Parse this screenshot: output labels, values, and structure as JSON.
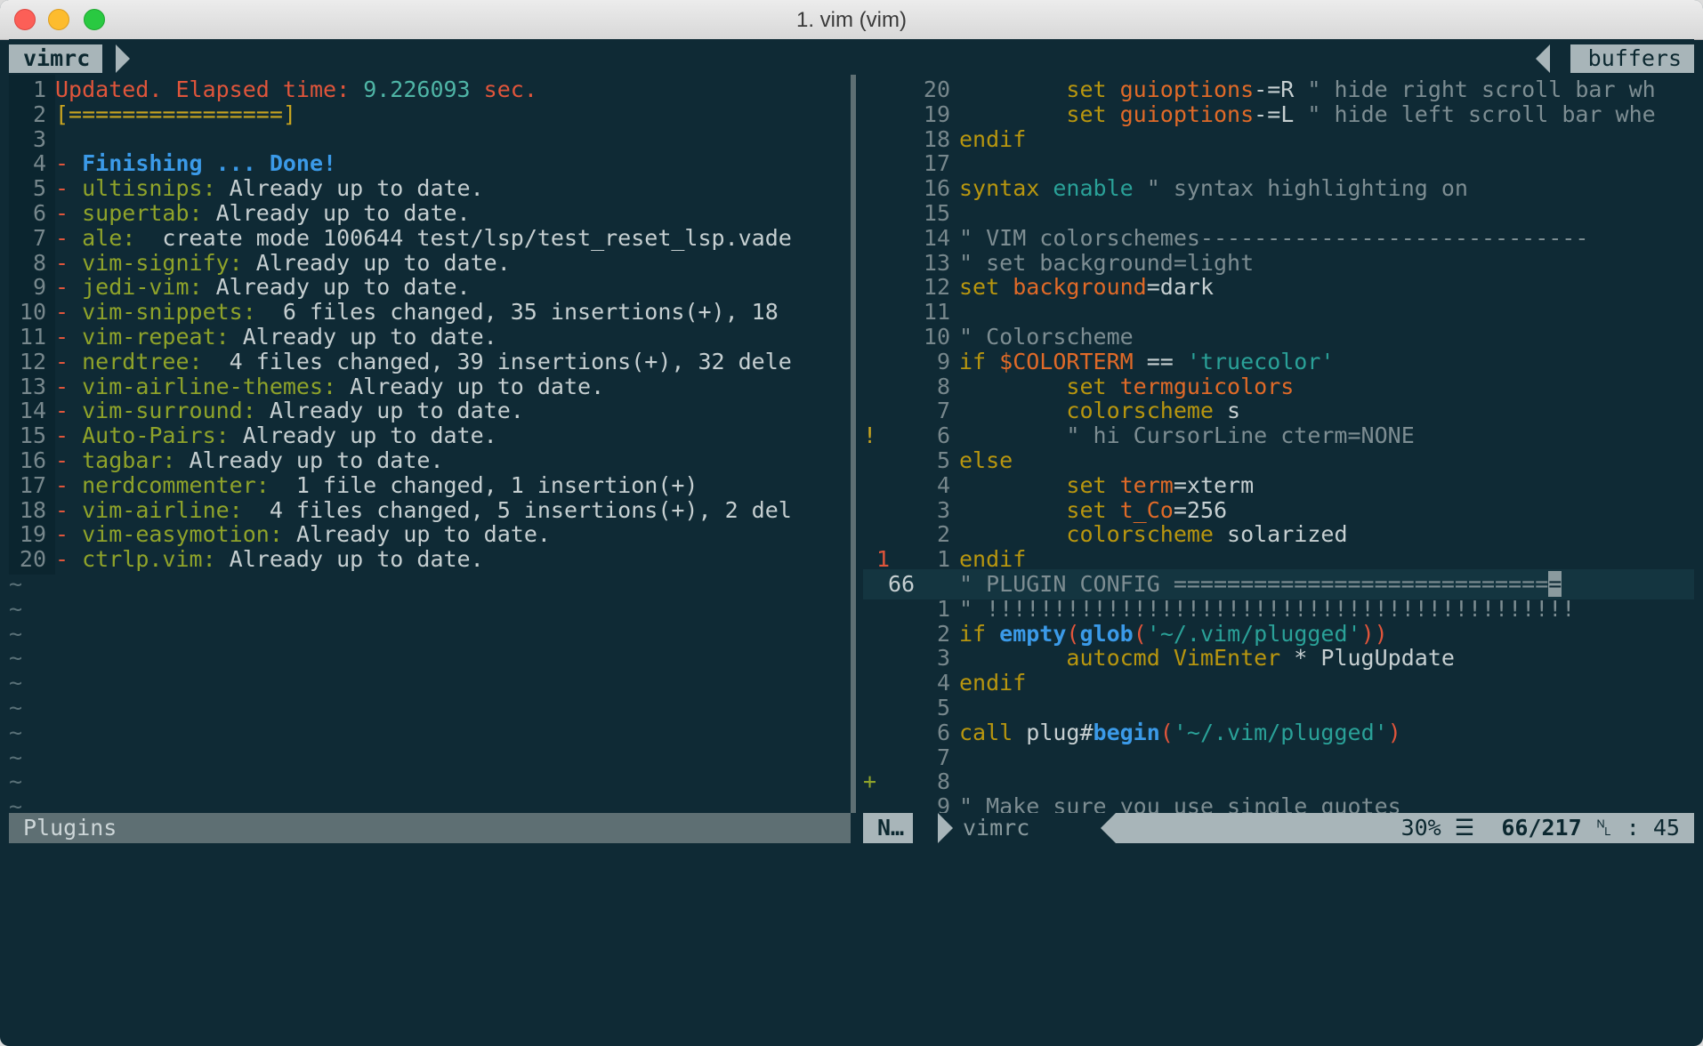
{
  "window": {
    "title": "1. vim (vim)"
  },
  "tabline": {
    "active_tab": "vimrc",
    "right_label": "buffers"
  },
  "left_pane": {
    "lines": [
      {
        "n": "1",
        "segs": [
          [
            "Updated. Elapsed time: ",
            "red"
          ],
          [
            "9.226093",
            "teal"
          ],
          [
            " sec.",
            "red"
          ]
        ]
      },
      {
        "n": "2",
        "segs": [
          [
            "[================]",
            "yellow"
          ]
        ]
      },
      {
        "n": "3",
        "segs": []
      },
      {
        "n": "4",
        "segs": [
          [
            "- ",
            "red"
          ],
          [
            "Finishing ... Done!",
            "blue"
          ]
        ]
      },
      {
        "n": "5",
        "segs": [
          [
            "- ",
            "red"
          ],
          [
            "ultisnips:",
            "green"
          ],
          [
            " Already up to date.",
            "text"
          ]
        ]
      },
      {
        "n": "6",
        "segs": [
          [
            "- ",
            "red"
          ],
          [
            "supertab:",
            "green"
          ],
          [
            " Already up to date.",
            "text"
          ]
        ]
      },
      {
        "n": "7",
        "segs": [
          [
            "- ",
            "red"
          ],
          [
            "ale:",
            "green"
          ],
          [
            "  create mode 100644 test/lsp/test_reset_lsp.vade",
            "text"
          ]
        ]
      },
      {
        "n": "8",
        "segs": [
          [
            "- ",
            "red"
          ],
          [
            "vim-signify:",
            "green"
          ],
          [
            " Already up to date.",
            "text"
          ]
        ]
      },
      {
        "n": "9",
        "segs": [
          [
            "- ",
            "red"
          ],
          [
            "jedi-vim:",
            "green"
          ],
          [
            " Already up to date.",
            "text"
          ]
        ]
      },
      {
        "n": "10",
        "segs": [
          [
            "- ",
            "red"
          ],
          [
            "vim-snippets:",
            "green"
          ],
          [
            "  6 files changed, 35 insertions(+), 18",
            "text"
          ]
        ]
      },
      {
        "n": "11",
        "segs": [
          [
            "- ",
            "red"
          ],
          [
            "vim-repeat:",
            "green"
          ],
          [
            " Already up to date.",
            "text"
          ]
        ]
      },
      {
        "n": "12",
        "segs": [
          [
            "- ",
            "red"
          ],
          [
            "nerdtree:",
            "green"
          ],
          [
            "  4 files changed, 39 insertions(+), 32 dele",
            "text"
          ]
        ]
      },
      {
        "n": "13",
        "segs": [
          [
            "- ",
            "red"
          ],
          [
            "vim-airline-themes:",
            "green"
          ],
          [
            " Already up to date.",
            "text"
          ]
        ]
      },
      {
        "n": "14",
        "segs": [
          [
            "- ",
            "red"
          ],
          [
            "vim-surround:",
            "green"
          ],
          [
            " Already up to date.",
            "text"
          ]
        ]
      },
      {
        "n": "15",
        "segs": [
          [
            "- ",
            "red"
          ],
          [
            "Auto-Pairs:",
            "green"
          ],
          [
            " Already up to date.",
            "text"
          ]
        ]
      },
      {
        "n": "16",
        "segs": [
          [
            "- ",
            "red"
          ],
          [
            "tagbar:",
            "green"
          ],
          [
            " Already up to date.",
            "text"
          ]
        ]
      },
      {
        "n": "17",
        "segs": [
          [
            "- ",
            "red"
          ],
          [
            "nerdcommenter:",
            "green"
          ],
          [
            "  1 file changed, 1 insertion(+)",
            "text"
          ]
        ]
      },
      {
        "n": "18",
        "segs": [
          [
            "- ",
            "red"
          ],
          [
            "vim-airline:",
            "green"
          ],
          [
            "  4 files changed, 5 insertions(+), 2 del",
            "text"
          ]
        ]
      },
      {
        "n": "19",
        "segs": [
          [
            "- ",
            "red"
          ],
          [
            "vim-easymotion:",
            "green"
          ],
          [
            " Already up to date.",
            "text"
          ]
        ]
      },
      {
        "n": "20",
        "segs": [
          [
            "- ",
            "red"
          ],
          [
            "ctrlp.vim:",
            "green"
          ],
          [
            " Already up to date.",
            "text"
          ]
        ]
      }
    ],
    "tilde": "~",
    "tilde_count": 10
  },
  "right_pane": {
    "lines": [
      {
        "sign": "",
        "n": "20",
        "segs": [
          [
            "        set ",
            "kw"
          ],
          [
            "guioptions",
            "orange"
          ],
          [
            "-=R ",
            "op"
          ],
          [
            "\" hide right scroll bar wh",
            "gray"
          ]
        ]
      },
      {
        "sign": "",
        "n": "19",
        "segs": [
          [
            "        set ",
            "kw"
          ],
          [
            "guioptions",
            "orange"
          ],
          [
            "-=L ",
            "op"
          ],
          [
            "\" hide left scroll bar whe",
            "gray"
          ]
        ]
      },
      {
        "sign": "",
        "n": "18",
        "segs": [
          [
            "endif",
            "kw"
          ]
        ]
      },
      {
        "sign": "",
        "n": "17",
        "segs": []
      },
      {
        "sign": "",
        "n": "16",
        "segs": [
          [
            "syntax ",
            "kw"
          ],
          [
            "enable ",
            "str"
          ],
          [
            "\" syntax highlighting on",
            "gray"
          ]
        ]
      },
      {
        "sign": "",
        "n": "15",
        "segs": []
      },
      {
        "sign": "",
        "n": "14",
        "segs": [
          [
            "\" VIM colorschemes-----------------------------",
            "gray"
          ]
        ]
      },
      {
        "sign": "",
        "n": "13",
        "segs": [
          [
            "\" set background=light",
            "gray"
          ]
        ]
      },
      {
        "sign": "",
        "n": "12",
        "segs": [
          [
            "set ",
            "kw"
          ],
          [
            "background",
            "orange"
          ],
          [
            "=dark",
            "text"
          ]
        ]
      },
      {
        "sign": "",
        "n": "11",
        "segs": []
      },
      {
        "sign": "",
        "n": "10",
        "segs": [
          [
            "\" Colorscheme",
            "gray"
          ]
        ]
      },
      {
        "sign": "",
        "n": "9",
        "segs": [
          [
            "if ",
            "kw"
          ],
          [
            "$COLORTERM",
            "orange"
          ],
          [
            " == ",
            "text"
          ],
          [
            "'truecolor'",
            "str"
          ]
        ]
      },
      {
        "sign": "",
        "n": "8",
        "segs": [
          [
            "        set ",
            "kw"
          ],
          [
            "termguicolors",
            "orange"
          ]
        ]
      },
      {
        "sign": "",
        "n": "7",
        "segs": [
          [
            "        colorscheme ",
            "kw"
          ],
          [
            "s",
            "text"
          ]
        ]
      },
      {
        "sign": "!",
        "n": "6",
        "segs": [
          [
            "        \" hi CursorLine cterm=NONE",
            "gray"
          ]
        ]
      },
      {
        "sign": "",
        "n": "5",
        "segs": [
          [
            "else",
            "kw"
          ]
        ]
      },
      {
        "sign": "",
        "n": "4",
        "segs": [
          [
            "        set ",
            "kw"
          ],
          [
            "term",
            "orange"
          ],
          [
            "=xterm",
            "text"
          ]
        ]
      },
      {
        "sign": "",
        "n": "3",
        "segs": [
          [
            "        set ",
            "kw"
          ],
          [
            "t_Co",
            "orange"
          ],
          [
            "=256",
            "text"
          ]
        ]
      },
      {
        "sign": "",
        "n": "2",
        "segs": [
          [
            "        colorscheme ",
            "kw"
          ],
          [
            "solarized",
            "text"
          ]
        ]
      },
      {
        "sign": "_1",
        "n": "1",
        "segs": [
          [
            "endif",
            "kw"
          ]
        ]
      },
      {
        "sign": "",
        "n": "66",
        "cur": true,
        "segs": [
          [
            "\" PLUGIN CONFIG ============================",
            "gray"
          ],
          [
            "=",
            "cursor"
          ]
        ]
      },
      {
        "sign": "",
        "n": "1",
        "segs": [
          [
            "\" !!!!!!!!!!!!!!!!!!!!!!!!!!!!!!!!!!!!!!!!!!!!",
            "gray"
          ]
        ]
      },
      {
        "sign": "",
        "n": "2",
        "segs": [
          [
            "if ",
            "kw"
          ],
          [
            "empty",
            "blue"
          ],
          [
            "(",
            "red"
          ],
          [
            "glob",
            "blue"
          ],
          [
            "(",
            "red"
          ],
          [
            "'~/.vim/plugged'",
            "str"
          ],
          [
            "))",
            "red"
          ]
        ]
      },
      {
        "sign": "",
        "n": "3",
        "segs": [
          [
            "        autocmd ",
            "kw"
          ],
          [
            "VimEnter",
            "kw"
          ],
          [
            " * PlugUpdate",
            "text"
          ]
        ]
      },
      {
        "sign": "",
        "n": "4",
        "segs": [
          [
            "endif",
            "kw"
          ]
        ]
      },
      {
        "sign": "",
        "n": "5",
        "segs": []
      },
      {
        "sign": "",
        "n": "6",
        "segs": [
          [
            "call ",
            "kw"
          ],
          [
            "plug#",
            "text"
          ],
          [
            "begin",
            "blue"
          ],
          [
            "(",
            "red"
          ],
          [
            "'~/.vim/plugged'",
            "str"
          ],
          [
            ")",
            "red"
          ]
        ]
      },
      {
        "sign": "",
        "n": "7",
        "segs": []
      },
      {
        "sign": "+",
        "n": "8",
        "segs": []
      },
      {
        "sign": "",
        "n": "9",
        "segs": [
          [
            "\" Make sure you use single quotes",
            "gray"
          ]
        ]
      }
    ]
  },
  "statusline": {
    "left_buffer": "Plugins",
    "mode": "N…",
    "file": "vimrc",
    "percent": "30%",
    "menu_glyph": "☰",
    "position": "66/217",
    "ln_glyph": "␤",
    "column": ": 45"
  },
  "colors": {
    "red": "#e0553b",
    "teal": "#4fb5a6",
    "yellow": "#c9a520",
    "blue": "#3b9ae8",
    "green": "#8fa32a",
    "text": "#c6cfd1",
    "gray": "#7d8d92",
    "orange": "#e06a28",
    "kw": "#b8960f",
    "str": "#2aa198",
    "op": "#c6cfd1"
  }
}
